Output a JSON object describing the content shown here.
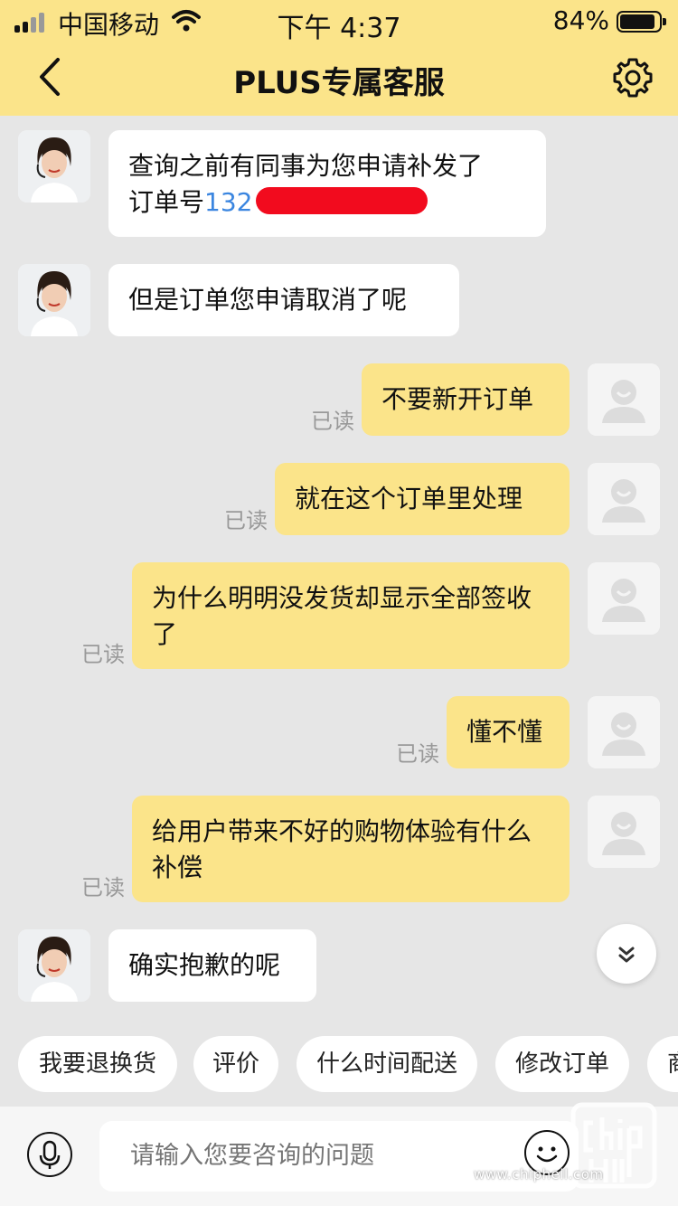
{
  "status_bar": {
    "carrier": "中国移动",
    "time": "下午 4:37",
    "battery": "84%"
  },
  "header": {
    "title": "PLUS专属客服"
  },
  "messages": [
    {
      "from": "agent",
      "text": "查询之前有同事为您申请补发了",
      "text2": "订单号",
      "order_prefix": "132"
    },
    {
      "from": "agent",
      "text": "但是订单您申请取消了呢"
    },
    {
      "from": "user",
      "text": "不要新开订单",
      "status": "已读"
    },
    {
      "from": "user",
      "text": "就在这个订单里处理",
      "status": "已读"
    },
    {
      "from": "user",
      "text": "为什么明明没发货却显示全部签收了",
      "status": "已读"
    },
    {
      "from": "user",
      "text": "懂不懂",
      "status": "已读"
    },
    {
      "from": "user",
      "text": "给用户带来不好的购物体验有什么补偿",
      "status": "已读"
    },
    {
      "from": "agent",
      "text": "确实抱歉的呢"
    }
  ],
  "quick_replies": [
    "我要退换货",
    "评价",
    "什么时间配送",
    "修改订单",
    "商"
  ],
  "input": {
    "placeholder": "请输入您要咨询的问题"
  },
  "watermark": {
    "url": "www.chiphell.com"
  },
  "colors": {
    "accent": "#fbe48a",
    "link": "#3b86e0",
    "background": "#e6e6e6"
  }
}
